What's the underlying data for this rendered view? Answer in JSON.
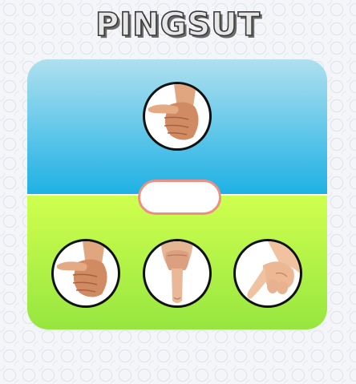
{
  "app": {
    "title": "PINGSUT"
  },
  "opponent": {
    "hand": "thumb-hand-icon"
  },
  "result": {
    "text": ""
  },
  "choices": [
    {
      "icon": "thumb-hand-icon"
    },
    {
      "icon": "pointing-finger-icon"
    },
    {
      "icon": "pinky-finger-icon"
    }
  ],
  "colors": {
    "top_gradient": [
      "#afe0ef",
      "#1eb1e4"
    ],
    "bottom_gradient": [
      "#cfff4e",
      "#96e640"
    ],
    "result_border": "#ee8f84"
  }
}
